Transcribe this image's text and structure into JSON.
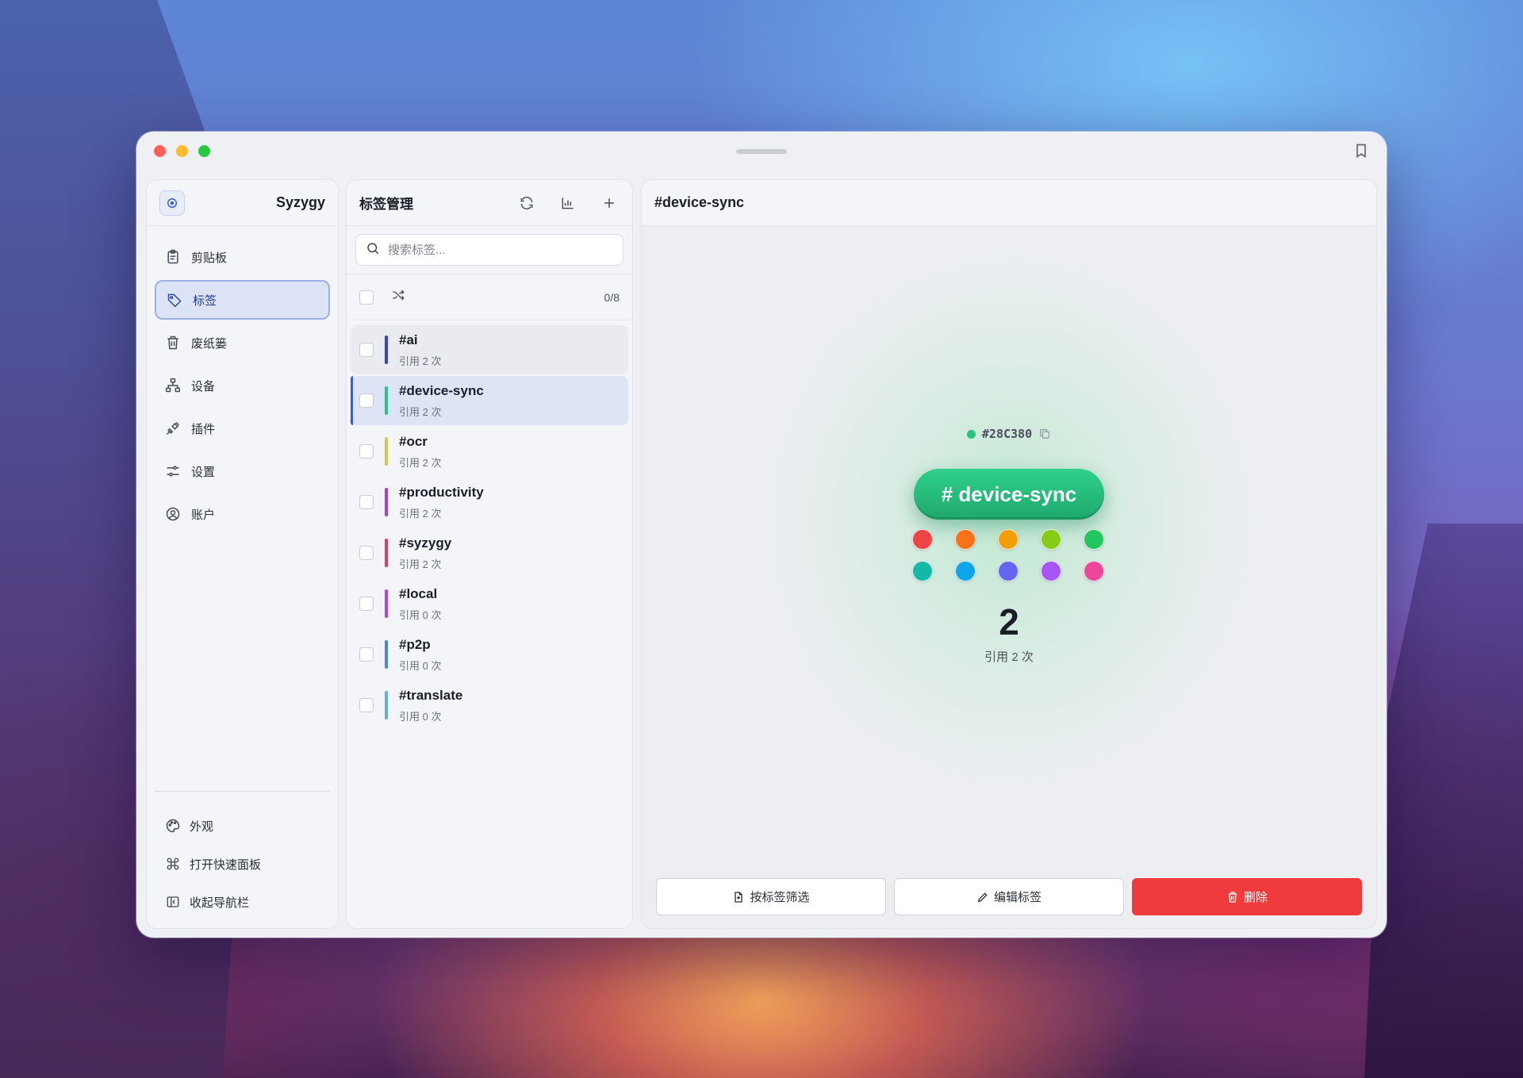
{
  "app": {
    "name": "Syzygy"
  },
  "sidebar": {
    "items": [
      {
        "label": "剪贴板",
        "icon": "clipboard-icon",
        "active": false
      },
      {
        "label": "标签",
        "icon": "tag-icon",
        "active": true
      },
      {
        "label": "废纸篓",
        "icon": "trash-icon",
        "active": false
      },
      {
        "label": "设备",
        "icon": "devices-icon",
        "active": false
      },
      {
        "label": "插件",
        "icon": "plugin-icon",
        "active": false
      },
      {
        "label": "设置",
        "icon": "settings-icon",
        "active": false
      },
      {
        "label": "账户",
        "icon": "account-icon",
        "active": false
      }
    ],
    "bottom": [
      {
        "label": "外观",
        "icon": "palette-icon"
      },
      {
        "label": "打开快速面板",
        "icon": "command-icon"
      },
      {
        "label": "收起导航栏",
        "icon": "collapse-sidebar-icon"
      }
    ]
  },
  "tags_panel": {
    "title": "标签管理",
    "search_placeholder": "搜索标签...",
    "select_count": "0/8",
    "tags": [
      {
        "name": "#ai",
        "refs": "引用 2 次",
        "color": "#3340c8",
        "state": "hover"
      },
      {
        "name": "#device-sync",
        "refs": "引用 2 次",
        "color": "#28C380",
        "state": "selected"
      },
      {
        "name": "#ocr",
        "refs": "引用 2 次",
        "color": "#dcc64a",
        "state": ""
      },
      {
        "name": "#productivity",
        "refs": "引用 2 次",
        "color": "#a93fc9",
        "state": ""
      },
      {
        "name": "#syzygy",
        "refs": "引用 2 次",
        "color": "#d9425e",
        "state": ""
      },
      {
        "name": "#local",
        "refs": "引用 0 次",
        "color": "#b444d8",
        "state": ""
      },
      {
        "name": "#p2p",
        "refs": "引用 0 次",
        "color": "#4a86e0",
        "state": ""
      },
      {
        "name": "#translate",
        "refs": "引用 0 次",
        "color": "#5fb0d8",
        "state": ""
      }
    ]
  },
  "detail": {
    "title": "#device-sync",
    "hex": "#28C380",
    "pill_label": "# device-sync",
    "pill_color": "#28C380",
    "palette": [
      "#ef4444",
      "#f97316",
      "#f59e0b",
      "#84cc16",
      "#22c55e",
      "#14b8a6",
      "#0ea5e9",
      "#6366f1",
      "#a855f7",
      "#ec4899"
    ],
    "ref_count": "2",
    "ref_label": "引用 2 次",
    "buttons": {
      "filter": "按标签筛选",
      "edit": "编辑标签",
      "delete": "删除"
    }
  }
}
